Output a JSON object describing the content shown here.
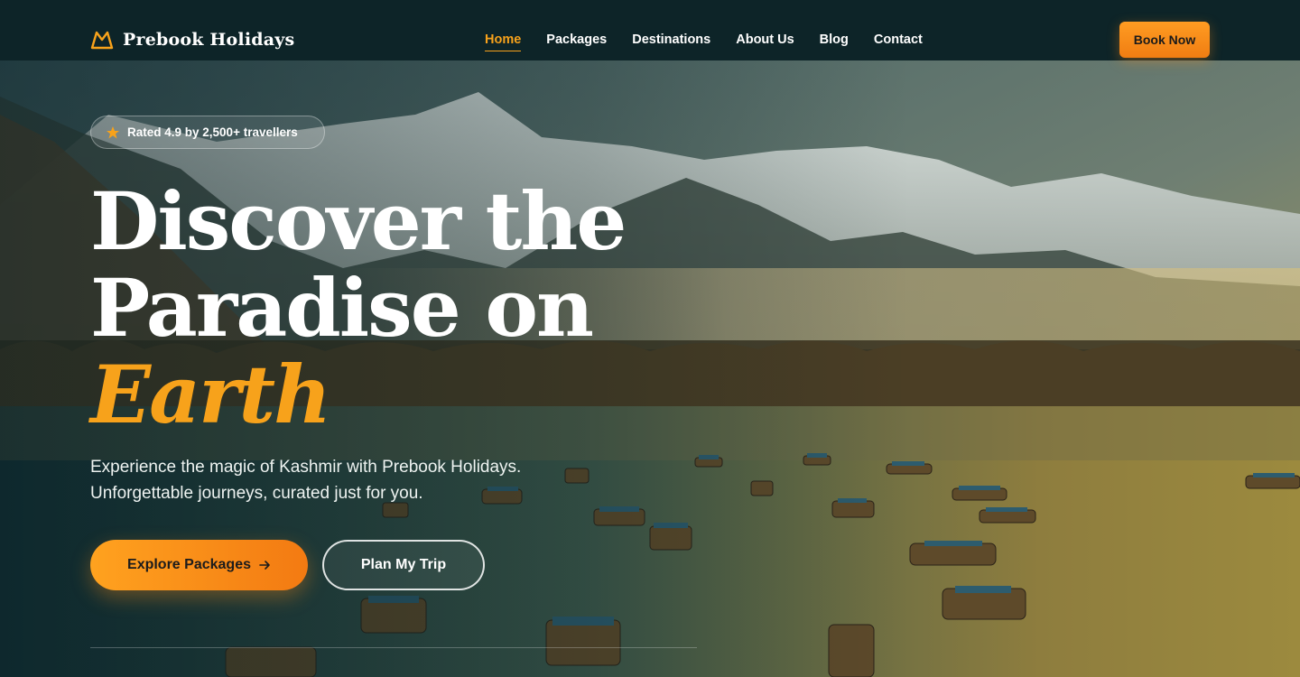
{
  "brand": {
    "name": "Prebook Holidays",
    "logo_icon": "mountain-icon",
    "accent_color": "#f7a21b"
  },
  "nav": {
    "items": [
      {
        "label": "Home",
        "active": true
      },
      {
        "label": "Packages",
        "active": false
      },
      {
        "label": "Destinations",
        "active": false
      },
      {
        "label": "About Us",
        "active": false
      },
      {
        "label": "Blog",
        "active": false
      },
      {
        "label": "Contact",
        "active": false
      }
    ],
    "cta_label": "Book Now"
  },
  "hero": {
    "rating_icon": "star-icon",
    "rating_text": "Rated 4.9 by 2,500+ travellers",
    "headline_line1": "Discover the",
    "headline_line2": "Paradise on",
    "headline_accent": "Earth",
    "subtitle_line1": "Experience the magic of Kashmir with Prebook Holidays.",
    "subtitle_line2": "Unforgettable journeys, curated just for you.",
    "primary_button": "Explore Packages",
    "primary_button_icon": "arrow-right-icon",
    "secondary_button": "Plan My Trip"
  }
}
